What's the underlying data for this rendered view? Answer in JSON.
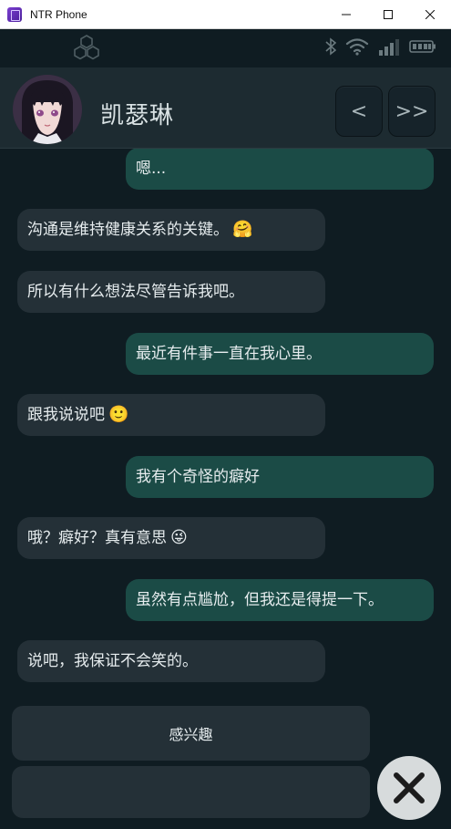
{
  "window": {
    "title": "NTR Phone"
  },
  "contact": {
    "name": "凯瑟琳"
  },
  "nav": {
    "prev_label": "<",
    "skip_label": ">>"
  },
  "messages": [
    {
      "side": "sent",
      "text": "嗯..."
    },
    {
      "side": "recv",
      "text": "沟通是维持健康关系的关键。",
      "emoji": "🤗"
    },
    {
      "side": "recv",
      "text": "所以有什么想法尽管告诉我吧。"
    },
    {
      "side": "sent",
      "text": "最近有件事一直在我心里。"
    },
    {
      "side": "recv",
      "text": "跟我说说吧",
      "emoji": "🙂"
    },
    {
      "side": "sent",
      "text": "我有个奇怪的癖好"
    },
    {
      "side": "recv",
      "text": "哦？癖好？真有意思",
      "emoji": "😜"
    },
    {
      "side": "sent",
      "text": "虽然有点尴尬，但我还是得提一下。"
    },
    {
      "side": "recv",
      "text": "说吧，我保证不会笑的。"
    }
  ],
  "choice": {
    "label": "感兴趣"
  },
  "colors": {
    "background": "#0f1c22",
    "received_bubble": "#243037",
    "sent_bubble": "#1b4b46",
    "header": "#1d2b31"
  }
}
